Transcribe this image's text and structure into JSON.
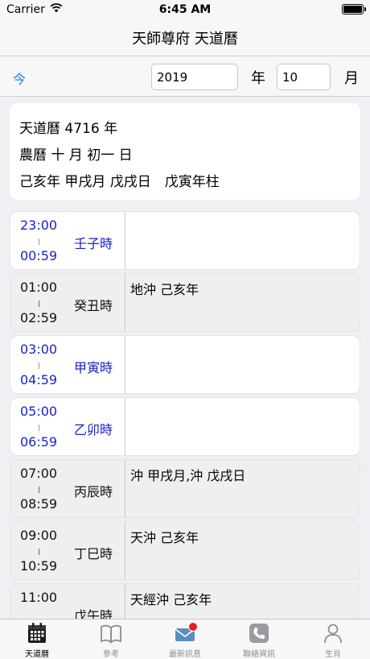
{
  "status_bar": {
    "carrier": "Carrier",
    "time": "6:45 AM"
  },
  "nav": {
    "title": "天師尊府 天道曆"
  },
  "toolbar": {
    "today_label": "今",
    "year_value": "2019",
    "year_unit": "年",
    "month_value": "10",
    "month_unit": "月"
  },
  "info": {
    "line1": "天道曆 4716 年",
    "line2": "農曆 十 月 初一 日",
    "line3": "己亥年 甲戌月 戊戌日　戊寅年柱"
  },
  "hours": [
    {
      "start": "23:00",
      "end": "00:59",
      "name": "壬子時",
      "note": "",
      "style": "lit"
    },
    {
      "start": "01:00",
      "end": "02:59",
      "name": "癸丑時",
      "note": "地沖 己亥年",
      "style": "dim"
    },
    {
      "start": "03:00",
      "end": "04:59",
      "name": "甲寅時",
      "note": "",
      "style": "lit"
    },
    {
      "start": "05:00",
      "end": "06:59",
      "name": "乙卯時",
      "note": "",
      "style": "lit"
    },
    {
      "start": "07:00",
      "end": "08:59",
      "name": "丙辰時",
      "note": "沖 甲戌月,沖 戊戌日",
      "style": "dim"
    },
    {
      "start": "09:00",
      "end": "10:59",
      "name": "丁巳時",
      "note": "天沖 己亥年",
      "style": "dim"
    },
    {
      "start": "11:00",
      "end": "",
      "name": "戊午時",
      "note": "天經沖 己亥年",
      "style": "dim"
    }
  ],
  "tabs": [
    {
      "label": "天道曆",
      "icon": "calendar-icon",
      "active": true
    },
    {
      "label": "參考",
      "icon": "book-icon",
      "active": false
    },
    {
      "label": "最新訊息",
      "icon": "envelope-icon",
      "active": false,
      "badge": true
    },
    {
      "label": "聯絡資訊",
      "icon": "phone-icon",
      "active": false
    },
    {
      "label": "生肖",
      "icon": "person-icon",
      "active": false
    }
  ],
  "colors": {
    "accent": "#147efb",
    "hour_lit_text": "#1a22c8",
    "hour_dim_bg": "#efefef",
    "badge": "#e02020"
  }
}
